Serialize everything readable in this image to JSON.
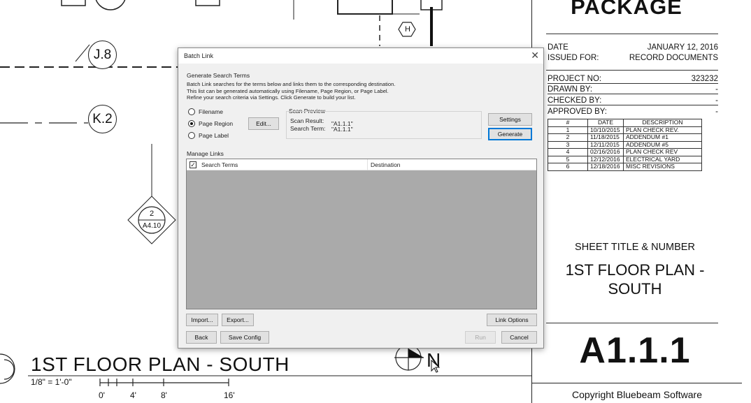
{
  "drawing": {
    "grid_bubbles": [
      "J.8",
      "K.2"
    ],
    "hex_tag": "H",
    "section_marker": {
      "number": "2",
      "sheet": "A4.10"
    },
    "plan_title": "1ST FLOOR PLAN - SOUTH",
    "scale_text": "1/8\" = 1'-0\"",
    "scale_labels": [
      "0'",
      "4'",
      "8'",
      "16'"
    ],
    "north_label": "N"
  },
  "title_block": {
    "package": "PACKAGE",
    "date_label": "DATE",
    "date_value": "JANUARY 12, 2016",
    "issued_label": "ISSUED FOR:",
    "issued_value": "RECORD DOCUMENTS",
    "project_label": "PROJECT NO:",
    "project_value": "323232",
    "drawn_label": "DRAWN BY:",
    "drawn_value": "-",
    "checked_label": "CHECKED BY:",
    "checked_value": "-",
    "approved_label": "APPROVED BY:",
    "approved_value": "-",
    "revisions": {
      "headers": [
        "#",
        "DATE",
        "DESCRIPTION"
      ],
      "rows": [
        [
          "1",
          "10/10/2015",
          "PLAN CHECK REV."
        ],
        [
          "2",
          "11/18/2015",
          "ADDENDUM #1"
        ],
        [
          "3",
          "12/11/2015",
          "ADDENDUM #5"
        ],
        [
          "4",
          "02/16/2016",
          "PLAN CHECK REV"
        ],
        [
          "5",
          "12/12/2016",
          "ELECTRICAL YARD"
        ],
        [
          "6",
          "12/18/2016",
          "MISC REVISIONS"
        ]
      ]
    },
    "sheet_title_label": "SHEET TITLE & NUMBER",
    "sheet_title_line1": "1ST FLOOR PLAN -",
    "sheet_title_line2": "SOUTH",
    "sheet_number": "A1.1.1",
    "copyright": "Copyright Bluebeam Software"
  },
  "dialog": {
    "title": "Batch Link",
    "close_glyph": "✕",
    "generate_group_label": "Generate Search Terms",
    "generate_desc_1": "Batch Link searches for the terms below and links them to the corresponding destination.",
    "generate_desc_2": "This list can be generated automatically using Filename, Page Region, or Page Label.",
    "generate_desc_3": "Refine your search criteria via Settings. Click Generate to build your list.",
    "options": [
      {
        "label": "Filename",
        "selected": false
      },
      {
        "label": "Page Region",
        "selected": true
      },
      {
        "label": "Page Label",
        "selected": false
      }
    ],
    "edit_button": "Edit...",
    "scan_preview_label": "Scan Preview",
    "scan_result_label": "Scan Result:",
    "scan_result_value": "\"A1.1.1\"",
    "search_term_label": "Search Term:",
    "search_term_value": "\"A1.1.1\"",
    "settings_button": "Settings",
    "generate_button": "Generate",
    "manage_links_label": "Manage Links",
    "columns": {
      "terms": "Search Terms",
      "destination": "Destination"
    },
    "select_all_checked": true,
    "import_button": "Import...",
    "export_button": "Export...",
    "link_options_button": "Link Options",
    "back_button": "Back",
    "save_config_button": "Save Config",
    "run_button": "Run",
    "cancel_button": "Cancel"
  }
}
